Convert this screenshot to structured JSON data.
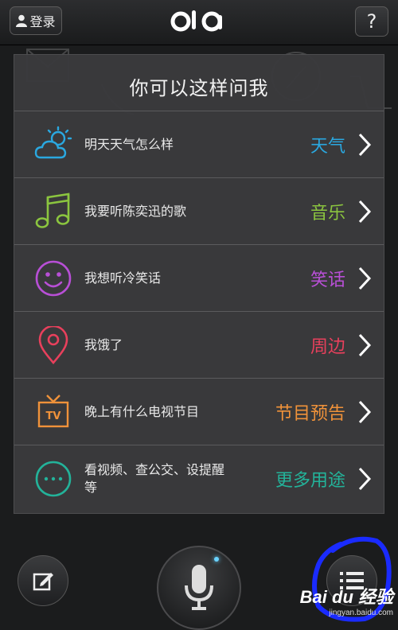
{
  "header": {
    "login_label": "登录",
    "logo_text": "OLA",
    "help_label": "?"
  },
  "panel": {
    "title": "你可以这样问我",
    "items": [
      {
        "icon": "weather-icon",
        "question": "明天天气怎么样",
        "category": "天气",
        "color": "#2aa8e0"
      },
      {
        "icon": "music-note-icon",
        "question": "我要听陈奕迅的歌",
        "category": "音乐",
        "color": "#8bc53f"
      },
      {
        "icon": "smiley-icon",
        "question": "我想听冷笑话",
        "category": "笑话",
        "color": "#b84fd6"
      },
      {
        "icon": "location-pin-icon",
        "question": "我饿了",
        "category": "周边",
        "color": "#e8405c"
      },
      {
        "icon": "tv-icon",
        "question": "晚上有什么电视节目",
        "category": "节目预告",
        "color": "#f0923a"
      },
      {
        "icon": "more-icon",
        "question": "看视频、查公交、设提醒等",
        "category": "更多用途",
        "color": "#23b39a"
      }
    ]
  },
  "footer": {
    "edit_icon": "edit-icon",
    "mic_icon": "microphone-icon",
    "menu_icon": "menu-list-icon"
  },
  "watermark": {
    "main": "Bai du 经验",
    "url": "jingyan.baidu.com"
  }
}
